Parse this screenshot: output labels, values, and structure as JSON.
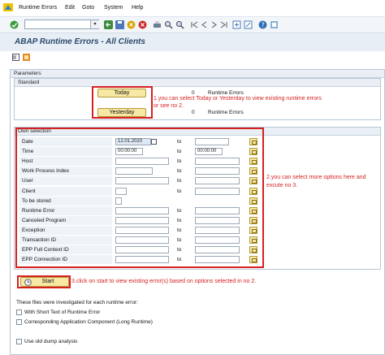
{
  "menu": {
    "items": [
      "Runtime Errors",
      "Edit",
      "Goto",
      "System",
      "Help"
    ]
  },
  "title": "ABAP Runtime Errors - All Clients",
  "parameters": {
    "frame_title": "Parameters",
    "standard_title": "Standard",
    "today_label": "Today",
    "yesterday_label": "Yesterday",
    "today_count": "0",
    "yesterday_count": "0",
    "today_result": "Runtime Errors",
    "yesterday_result": "Runtime Errors"
  },
  "own_selection": {
    "title": "Own selection",
    "to_label": "to",
    "rows": [
      {
        "label": "Date",
        "from": "12.01.2020",
        "to": ""
      },
      {
        "label": "Time",
        "from": "00:00:00",
        "to": "00:00:00"
      },
      {
        "label": "Host",
        "from": "",
        "to": ""
      },
      {
        "label": "Work Process Index",
        "from": "",
        "to": ""
      },
      {
        "label": "User",
        "from": "",
        "to": ""
      },
      {
        "label": "Client",
        "from": "",
        "to": ""
      },
      {
        "label": "To be stored",
        "from": "",
        "to": ""
      },
      {
        "label": "Runtime Error",
        "from": "",
        "to": ""
      },
      {
        "label": "Canceled Program",
        "from": "",
        "to": ""
      },
      {
        "label": "Exception",
        "from": "",
        "to": ""
      },
      {
        "label": "Transaction ID",
        "from": "",
        "to": ""
      },
      {
        "label": "EPP Full Context ID",
        "from": "",
        "to": ""
      },
      {
        "label": "EPP Connection ID",
        "from": "",
        "to": ""
      }
    ]
  },
  "start_label": "Start",
  "annotations": {
    "note1_line1": "1.you can select Today or Yesterday to view existing runtime errors",
    "note1_line2": "or see no 2.",
    "note2_line1": "2.you can select more options here and",
    "note2_line2": "excute no 3.",
    "note3": "3.click on start to view existing error(s) based on options selected in no 2."
  },
  "files": {
    "intro": "These files were investigated for each runtime error:",
    "opt1": "With Short Text of Runtime Error",
    "opt2": "Corresponding Application Component (Long Runtime)",
    "opt3": "Use old dump analysis"
  },
  "colors": {
    "annotation": "#d62020",
    "button": "#f7e8a3",
    "title": "#2c4a6b"
  }
}
